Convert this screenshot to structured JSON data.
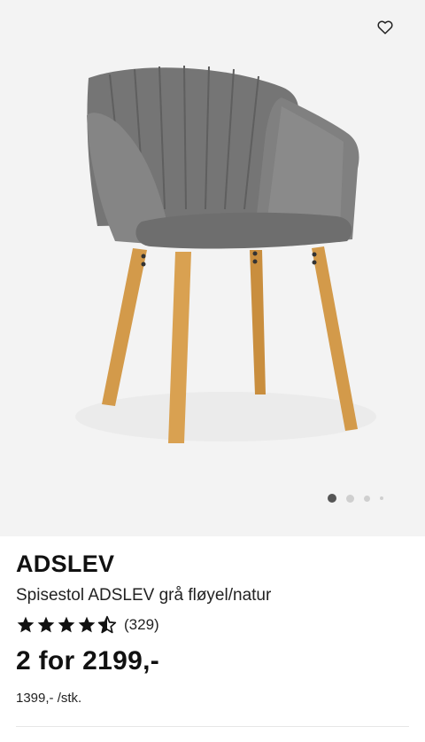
{
  "product": {
    "image_alt": "chair",
    "favorite_icon": "heart-outline-icon",
    "carousel": {
      "total": 4,
      "active": 1
    },
    "brand": "ADSLEV",
    "description": "Spisestol ADSLEV grå fløyel/natur",
    "rating": {
      "value": 4.5,
      "max": 5,
      "count_label": "(329)"
    },
    "price": "2 for 2199,-",
    "unit_price": "1399,- /stk."
  },
  "colors": {
    "image_bg": "#f3f3f3",
    "fabric": "#7a7a7a",
    "wood": "#d39a4a",
    "dot_active": "#555555",
    "dot_inactive": "#cfcfcf"
  }
}
